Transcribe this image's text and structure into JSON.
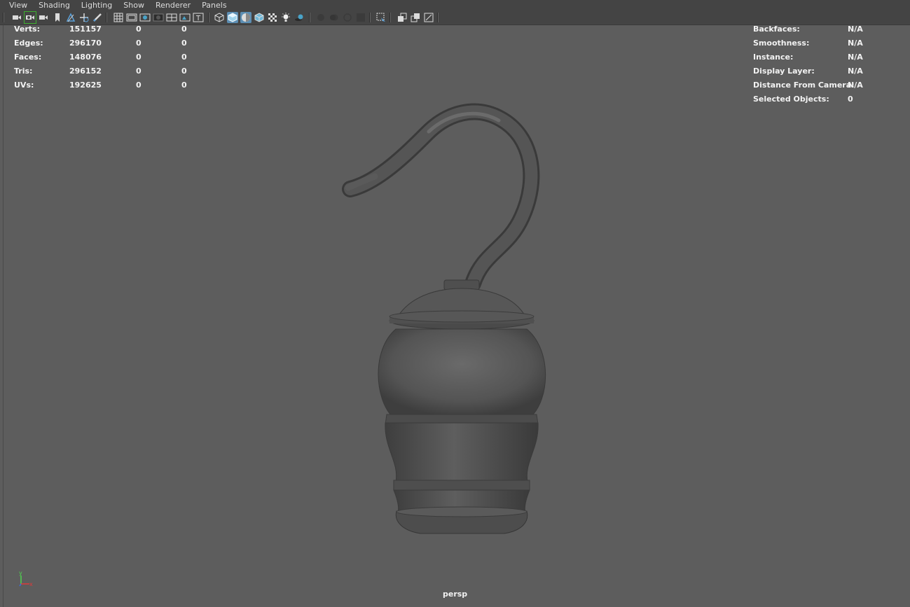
{
  "menu": [
    "View",
    "Shading",
    "Lighting",
    "Show",
    "Renderer",
    "Panels"
  ],
  "toolbar": {
    "icons": [
      "select-camera-icon",
      "camera-attributes-icon",
      "bookmark-camera-icon",
      "bookmark-icon",
      "image-plane-icon",
      "2d-pan-zoom-icon",
      "grease-pencil-icon",
      "grid-icon",
      "film-gate-icon",
      "resolution-gate-icon",
      "gate-mask-icon",
      "field-chart-icon",
      "safe-action-icon",
      "safe-title-icon",
      "wireframe-icon",
      "smooth-shade-icon",
      "default-material-icon",
      "wireframe-on-shaded-icon",
      "textured-icon",
      "use-all-lights-icon",
      "shadows-icon",
      "screen-space-ao-icon",
      "motion-blur-icon",
      "multisample-aa-icon",
      "depth-of-field-icon",
      "isolate-select-icon",
      "xray-icon",
      "xray-active-components-icon",
      "xray-joints-icon"
    ]
  },
  "hud_left": {
    "rows": [
      {
        "label": "Verts:",
        "v1": "151157",
        "v2": "0",
        "v3": "0"
      },
      {
        "label": "Edges:",
        "v1": "296170",
        "v2": "0",
        "v3": "0"
      },
      {
        "label": "Faces:",
        "v1": "148076",
        "v2": "0",
        "v3": "0"
      },
      {
        "label": "Tris:",
        "v1": "296152",
        "v2": "0",
        "v3": "0"
      },
      {
        "label": "UVs:",
        "v1": "192625",
        "v2": "0",
        "v3": "0"
      }
    ]
  },
  "hud_right": {
    "rows": [
      {
        "label": "Backfaces:",
        "value": "N/A"
      },
      {
        "label": "Smoothness:",
        "value": "N/A"
      },
      {
        "label": "Instance:",
        "value": "N/A"
      },
      {
        "label": "Display Layer:",
        "value": "N/A"
      },
      {
        "label": "Distance From Camera:",
        "value": "N/A"
      },
      {
        "label": "Selected Objects:",
        "value": "0"
      }
    ]
  },
  "camera_label": "persp",
  "axis": {
    "y": "y",
    "x": "x",
    "y_color": "#4fd44f",
    "x_color": "#e03a3a",
    "z_color": "#3a6ee0"
  },
  "colors": {
    "viewport_bg": "#5d5d5d",
    "toolbar_bg": "#444444",
    "active_button": "#5c8eb3",
    "selected_outline": "#3db02d"
  }
}
